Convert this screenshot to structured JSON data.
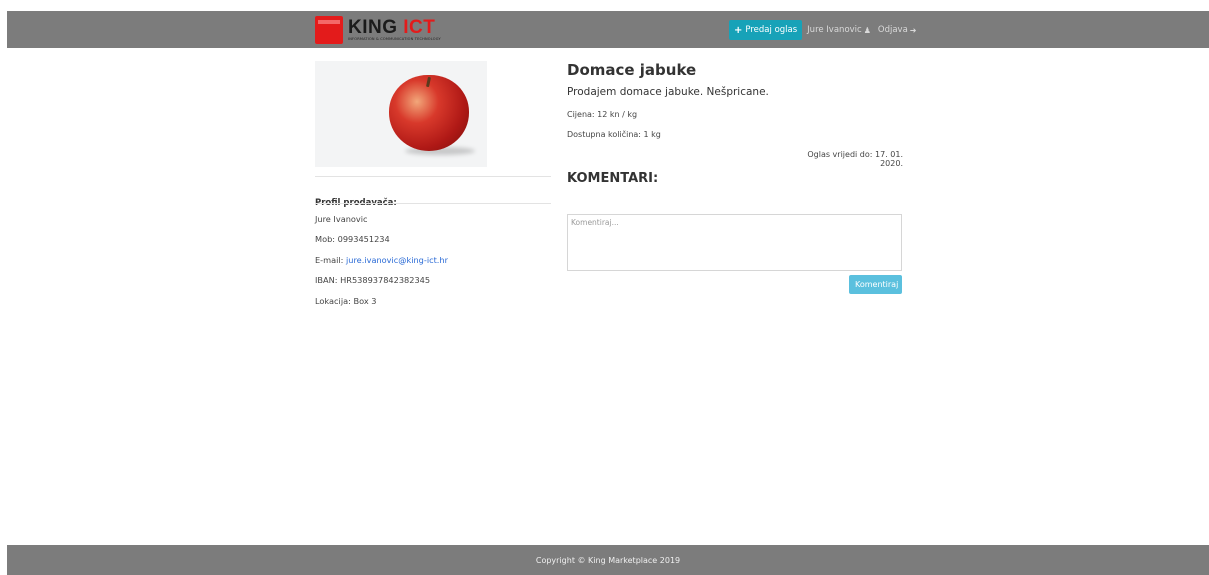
{
  "brand": {
    "name_part1": "KING",
    "name_part2": "ICT",
    "tagline": "INFORMATION & COMMUNICATION TECHNOLOGY"
  },
  "nav": {
    "sell_label": "Predaj oglas",
    "user_name": "Jure Ivanovic",
    "logout_label": "Odjava",
    "icons": [
      "plus-icon",
      "user-icon",
      "sign-out-icon"
    ]
  },
  "listing": {
    "title": "Domace jabuke",
    "description": "Prodajem domace jabuke. Nešpricane.",
    "price": "Cijena: 12 kn / kg",
    "quantity": "Dostupna količina: 1 kg",
    "valid_until": "Oglas vrijedi do: 17. 01. 2020."
  },
  "seller": {
    "heading": "Profil prodavača:",
    "name": "Jure Ivanovic",
    "phone": "Mob: 0993451234",
    "email_label": "E-mail: ",
    "email": "jure.ivanovic@king-ict.hr",
    "iban": "IBAN: HR538937842382345",
    "location": "Lokacija: Box 3"
  },
  "comments": {
    "heading": "KOMENTARI:",
    "placeholder": "Komentiraj...",
    "submit_label": "Komentiraj"
  },
  "footer": {
    "copyright": "Copyright © King Marketplace 2019"
  },
  "colors": {
    "navbar": "#7c7c7c",
    "primary_button": "#17a2b8",
    "comment_button": "#5bc0de",
    "brand_red": "#e31b1b"
  }
}
